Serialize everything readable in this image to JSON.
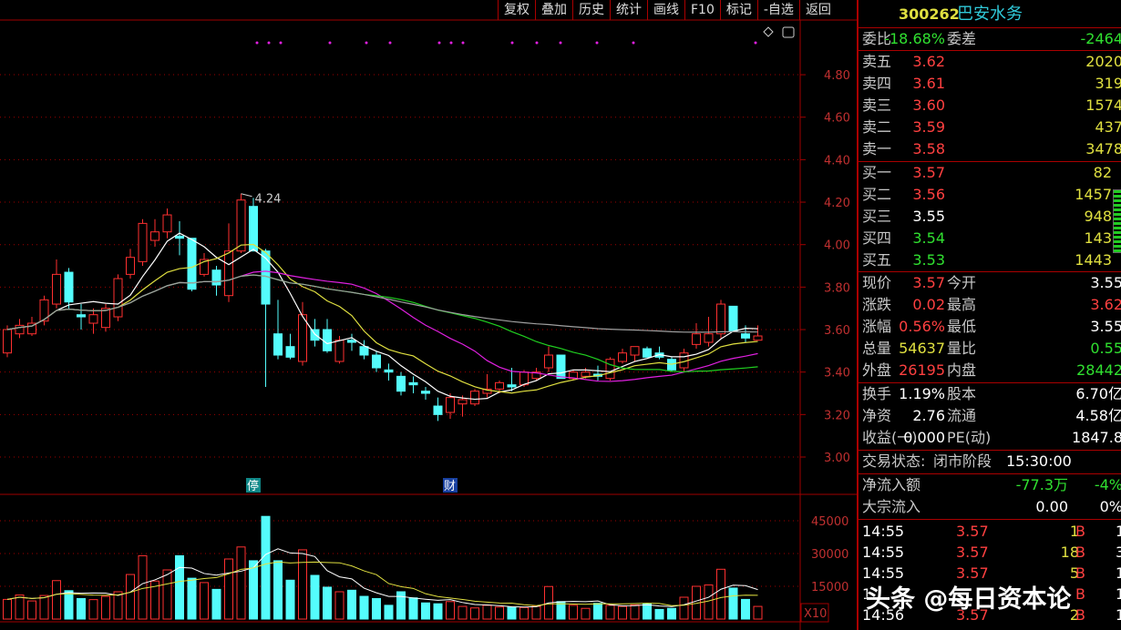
{
  "toolbar": [
    "复权",
    "叠加",
    "历史",
    "统计",
    "画线",
    "F10",
    "标记",
    "-自选",
    "返回"
  ],
  "stock": {
    "code": "300262",
    "name": "巴安水务"
  },
  "order_ratio": {
    "label": "委比",
    "value": "-18.68%",
    "label2": "委差",
    "value2": "-2464"
  },
  "sell": [
    {
      "label": "卖五",
      "price": "3.62",
      "vol": "2020"
    },
    {
      "label": "卖四",
      "price": "3.61",
      "vol": "319"
    },
    {
      "label": "卖三",
      "price": "3.60",
      "vol": "1574"
    },
    {
      "label": "卖二",
      "price": "3.59",
      "vol": "437"
    },
    {
      "label": "卖一",
      "price": "3.58",
      "vol": "3478"
    }
  ],
  "buy": [
    {
      "label": "买一",
      "price": "3.57",
      "vol": "82"
    },
    {
      "label": "买二",
      "price": "3.56",
      "vol": "1457"
    },
    {
      "label": "买三",
      "price": "3.55",
      "vol": "948"
    },
    {
      "label": "买四",
      "price": "3.54",
      "vol": "143"
    },
    {
      "label": "买五",
      "price": "3.53",
      "vol": "1443"
    }
  ],
  "quote": [
    {
      "l": "现价",
      "v": "3.57",
      "l2": "今开",
      "v2": "3.55",
      "c1": "r",
      "c2": "w"
    },
    {
      "l": "涨跌",
      "v": "0.02",
      "l2": "最高",
      "v2": "3.62",
      "c1": "r",
      "c2": "r"
    },
    {
      "l": "涨幅",
      "v": "0.56%",
      "l2": "最低",
      "v2": "3.55",
      "c1": "r",
      "c2": "w"
    },
    {
      "l": "总量",
      "v": "54637",
      "l2": "量比",
      "v2": "0.55",
      "c1": "y",
      "c2": "g"
    },
    {
      "l": "外盘",
      "v": "26195",
      "l2": "内盘",
      "v2": "28442",
      "c1": "r",
      "c2": "g"
    }
  ],
  "fundamentals": [
    {
      "l": "换手",
      "v": "1.19%",
      "l2": "股本",
      "v2": "6.70亿"
    },
    {
      "l": "净资",
      "v": "2.76",
      "l2": "流通",
      "v2": "4.58亿"
    },
    {
      "l": "收益(一)",
      "v": "0.000",
      "l2": "PE(动)",
      "v2": "1847.8"
    }
  ],
  "status": {
    "label": "交易状态:",
    "phase": "闭市阶段",
    "time": "15:30:00"
  },
  "flow": [
    {
      "l": "净流入额",
      "v": "-77.3万",
      "p": "-4%"
    },
    {
      "l": "大宗流入",
      "v": "0.00",
      "p": "0%"
    }
  ],
  "trades": [
    {
      "t": "14:55",
      "p": "3.57",
      "v": "1",
      "s": "B",
      "n": "1"
    },
    {
      "t": "14:55",
      "p": "3.57",
      "v": "18",
      "s": "B",
      "n": "3"
    },
    {
      "t": "14:55",
      "p": "3.57",
      "v": "5",
      "s": "B",
      "n": "1"
    },
    {
      "t": "1",
      "p": "",
      "v": "",
      "s": "B",
      "n": "1"
    },
    {
      "t": "14:56",
      "p": "3.57",
      "v": "2",
      "s": "B",
      "n": "1"
    }
  ],
  "watermark": "头条 @每日资本论",
  "colors": {
    "up": "#ff3030",
    "down": "#54fcfc",
    "grid": "#a00000",
    "ma5": "#ffffff",
    "ma10": "#e0e040",
    "ma20": "#e020e0",
    "ma30": "#20d020",
    "ma60": "#a0a0a0"
  },
  "chart_data": {
    "type": "candlestick",
    "price_axis": {
      "ticks": [
        "4.80",
        "4.60",
        "4.40",
        "4.20",
        "4.00",
        "3.80",
        "3.60",
        "3.40",
        "3.20",
        "3.00"
      ],
      "range": [
        3.0,
        4.8
      ]
    },
    "high_label": "4.24",
    "markers": [
      {
        "index": 20,
        "text": "停"
      },
      {
        "index": 36,
        "text": "财"
      }
    ],
    "ohlc": [
      [
        3.49,
        3.62,
        3.47,
        3.6
      ],
      [
        3.58,
        3.65,
        3.56,
        3.62
      ],
      [
        3.58,
        3.66,
        3.57,
        3.63
      ],
      [
        3.64,
        3.76,
        3.62,
        3.74
      ],
      [
        3.72,
        3.93,
        3.7,
        3.86
      ],
      [
        3.87,
        3.89,
        3.7,
        3.73
      ],
      [
        3.67,
        3.72,
        3.6,
        3.66
      ],
      [
        3.63,
        3.7,
        3.58,
        3.67
      ],
      [
        3.61,
        3.72,
        3.59,
        3.7
      ],
      [
        3.66,
        3.86,
        3.64,
        3.84
      ],
      [
        3.86,
        3.98,
        3.84,
        3.94
      ],
      [
        3.92,
        4.12,
        3.9,
        4.1
      ],
      [
        4.02,
        4.12,
        3.99,
        4.06
      ],
      [
        4.06,
        4.17,
        4.03,
        4.14
      ],
      [
        4.04,
        4.11,
        3.95,
        4.03
      ],
      [
        4.03,
        4.03,
        3.78,
        3.79
      ],
      [
        3.86,
        3.96,
        3.85,
        3.93
      ],
      [
        3.88,
        3.9,
        3.76,
        3.81
      ],
      [
        3.76,
        4.1,
        3.73,
        3.97
      ],
      [
        3.97,
        4.24,
        3.96,
        4.21
      ],
      [
        4.18,
        4.22,
        3.97,
        3.97
      ],
      [
        3.97,
        3.98,
        3.33,
        3.72
      ],
      [
        3.58,
        3.74,
        3.46,
        3.48
      ],
      [
        3.52,
        3.58,
        3.46,
        3.47
      ],
      [
        3.45,
        3.73,
        3.43,
        3.67
      ],
      [
        3.6,
        3.65,
        3.52,
        3.55
      ],
      [
        3.6,
        3.65,
        3.49,
        3.5
      ],
      [
        3.45,
        3.57,
        3.44,
        3.55
      ],
      [
        3.55,
        3.58,
        3.5,
        3.54
      ],
      [
        3.52,
        3.55,
        3.46,
        3.48
      ],
      [
        3.48,
        3.5,
        3.4,
        3.42
      ],
      [
        3.41,
        3.44,
        3.36,
        3.4
      ],
      [
        3.38,
        3.4,
        3.29,
        3.31
      ],
      [
        3.35,
        3.38,
        3.3,
        3.34
      ],
      [
        3.31,
        3.33,
        3.27,
        3.3
      ],
      [
        3.24,
        3.28,
        3.17,
        3.2
      ],
      [
        3.21,
        3.3,
        3.18,
        3.28
      ],
      [
        3.25,
        3.29,
        3.19,
        3.27
      ],
      [
        3.25,
        3.32,
        3.24,
        3.31
      ],
      [
        3.3,
        3.39,
        3.28,
        3.32
      ],
      [
        3.32,
        3.36,
        3.3,
        3.35
      ],
      [
        3.34,
        3.42,
        3.31,
        3.33
      ],
      [
        3.34,
        3.41,
        3.33,
        3.4
      ],
      [
        3.37,
        3.42,
        3.36,
        3.4
      ],
      [
        3.42,
        3.52,
        3.4,
        3.48
      ],
      [
        3.48,
        3.48,
        3.37,
        3.37
      ],
      [
        3.37,
        3.41,
        3.36,
        3.4
      ],
      [
        3.38,
        3.42,
        3.37,
        3.4
      ],
      [
        3.39,
        3.43,
        3.36,
        3.38
      ],
      [
        3.37,
        3.47,
        3.36,
        3.46
      ],
      [
        3.45,
        3.51,
        3.44,
        3.49
      ],
      [
        3.48,
        3.52,
        3.45,
        3.52
      ],
      [
        3.51,
        3.52,
        3.47,
        3.47
      ],
      [
        3.49,
        3.52,
        3.46,
        3.47
      ],
      [
        3.46,
        3.47,
        3.4,
        3.41
      ],
      [
        3.42,
        3.51,
        3.4,
        3.49
      ],
      [
        3.53,
        3.63,
        3.51,
        3.58
      ],
      [
        3.54,
        3.66,
        3.52,
        3.58
      ],
      [
        3.58,
        3.74,
        3.56,
        3.72
      ],
      [
        3.71,
        3.71,
        3.59,
        3.59
      ],
      [
        3.58,
        3.62,
        3.54,
        3.56
      ],
      [
        3.55,
        3.62,
        3.55,
        3.57
      ]
    ],
    "volume": [
      9000,
      11000,
      8300,
      10800,
      17600,
      13000,
      9400,
      8900,
      10400,
      12500,
      20400,
      29000,
      17400,
      22500,
      29000,
      18700,
      16700,
      13600,
      27500,
      33000,
      26700,
      47000,
      26700,
      17800,
      31700,
      20000,
      14600,
      12500,
      13200,
      10400,
      9400,
      6300,
      12500,
      9700,
      7400,
      7000,
      8000,
      5800,
      5100,
      6300,
      5500,
      5500,
      5300,
      5800,
      14900,
      8000,
      6300,
      4900,
      7200,
      6300,
      5800,
      6500,
      7000,
      4400,
      4900,
      10000,
      15000,
      15600,
      22800,
      14200,
      9000,
      5800
    ],
    "volume_axis": {
      "ticks": [
        "45000",
        "30000",
        "15000"
      ],
      "range": [
        0,
        50000
      ],
      "unit": "X10"
    },
    "moving_averages": [
      5,
      10,
      20,
      30,
      60
    ]
  }
}
